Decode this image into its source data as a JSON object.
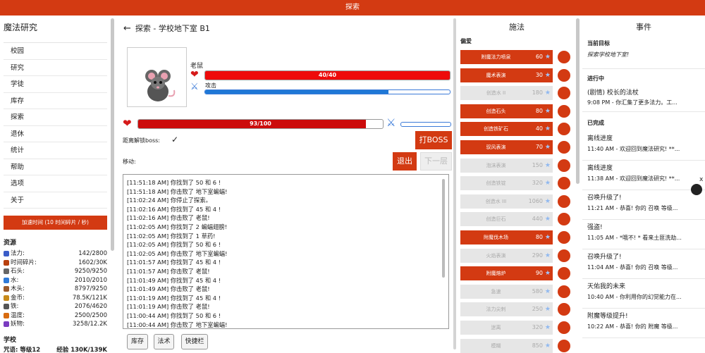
{
  "topbar": {
    "title": "探索"
  },
  "left": {
    "title": "魔法研究",
    "nav": [
      "校园",
      "研究",
      "学徒",
      "库存",
      "探索",
      "退休",
      "统计",
      "帮助",
      "选项",
      "关于"
    ],
    "accelerate": "加速时间 (10 时间碎片 / 秒)",
    "resources_title": "资源",
    "resources": [
      {
        "icon": "star-icon",
        "color": "#3a5cc8",
        "name": "法力:",
        "value": "142/2800"
      },
      {
        "icon": "time-shard-icon",
        "color": "#b8400e",
        "name": "时间碎片:",
        "value": "1602/30K"
      },
      {
        "icon": "stone-icon",
        "color": "#666666",
        "name": "石头:",
        "value": "9250/9250"
      },
      {
        "icon": "water-icon",
        "color": "#2f7ad8",
        "name": "水:",
        "value": "2010/2010"
      },
      {
        "icon": "wood-icon",
        "color": "#9a5a2c",
        "name": "木头:",
        "value": "8797/9250"
      },
      {
        "icon": "gold-icon",
        "color": "#c88a1a",
        "name": "金币:",
        "value": "78.5K/121K"
      },
      {
        "icon": "iron-icon",
        "color": "#555555",
        "name": "铁:",
        "value": "2076/4620"
      },
      {
        "icon": "heat-icon",
        "color": "#d86b10",
        "name": "温度:",
        "value": "2500/2500"
      },
      {
        "icon": "potion-icon",
        "color": "#7a3cc0",
        "name": "妖物:",
        "value": "3258/12.2K"
      }
    ],
    "school_title": "学校",
    "school_level": "咒语: 等级12",
    "school_exp": "经验 130K/139K"
  },
  "main": {
    "back_icon": "arrow-left-icon",
    "title": "探索 - 学校地下室 B1",
    "monster_name": "老鼠",
    "monster_hp_text": "40/40",
    "monster_hp_pct": 100,
    "monster_attack_label": "攻击",
    "monster_attack_pct": 75,
    "player_hp_text": "93/100",
    "player_hp_pct": 93,
    "player_attack_pct": 0,
    "boss_label": "距离解锁boss:",
    "boss_check": "✓",
    "boss_button": "打BOSS",
    "move_label": "移动:",
    "exit_button": "退出",
    "next_button": "下一层",
    "log": [
      "[11:51:18 AM] 你找到了 50 和 6 !",
      "[11:51:18 AM] 你击败了 地下室蝙蝠!",
      "[11:02:24 AM] 你停止了探索。",
      "[11:02:16 AM] 你找到了 45 和 4 !",
      "[11:02:16 AM] 你击败了 老鼠!",
      "[11:02:05 AM] 你找到了 2 蝙蝠翅膀!",
      "[11:02:05 AM] 你找到了 1 草药!",
      "[11:02:05 AM] 你找到了 50 和 6 !",
      "[11:02:05 AM] 你击败了 地下室蝙蝠!",
      "[11:01:57 AM] 你找到了 45 和 4 !",
      "[11:01:57 AM] 你击败了 老鼠!",
      "[11:01:49 AM] 你找到了 45 和 4 !",
      "[11:01:49 AM] 你击败了 老鼠!",
      "[11:01:19 AM] 你找到了 45 和 4 !",
      "[11:01:19 AM] 你击败了 老鼠!",
      "[11:00:44 AM] 你找到了 50 和 6 !",
      "[11:00:44 AM] 你击败了 地下室蝙蝠!"
    ],
    "tabs": [
      "库存",
      "法术",
      "快捷栏"
    ]
  },
  "spells": {
    "title": "施法",
    "fav_label": "偏爱",
    "items": [
      {
        "name": "附魔法力喷泉",
        "count": "60",
        "on": true
      },
      {
        "name": "魔术表演",
        "count": "30",
        "on": true
      },
      {
        "name": "创造水 II",
        "count": "180",
        "on": false
      },
      {
        "name": "创造石头",
        "count": "80",
        "on": true
      },
      {
        "name": "创造铁矿石",
        "count": "40",
        "on": true
      },
      {
        "name": "驭风表演",
        "count": "70",
        "on": true
      },
      {
        "name": "泡沫表演",
        "count": "150",
        "on": false
      },
      {
        "name": "创造铁锭",
        "count": "320",
        "on": false
      },
      {
        "name": "创造水 III",
        "count": "1060",
        "on": false
      },
      {
        "name": "创造巨石",
        "count": "440",
        "on": false
      },
      {
        "name": "附魔伐木场",
        "count": "80",
        "on": true
      },
      {
        "name": "火焰表演",
        "count": "290",
        "on": false
      },
      {
        "name": "附魔熔炉",
        "count": "90",
        "on": true
      },
      {
        "name": "急速",
        "count": "580",
        "on": false
      },
      {
        "name": "法力尖刺",
        "count": "250",
        "on": false
      },
      {
        "name": "迷离",
        "count": "320",
        "on": false
      },
      {
        "name": "模糊",
        "count": "850",
        "on": false
      }
    ]
  },
  "events": {
    "title": "事件",
    "current_goal_label": "当前目标",
    "current_goal": "探索学校地下室!",
    "in_progress_label": "进行中",
    "in_progress": [
      {
        "title": "(剧情) 校长的法杖",
        "detail": "9:08 PM - 你汇集了更多法力。工..."
      }
    ],
    "done_label": "已完成",
    "done": [
      {
        "title": "离线进度",
        "detail": "11:40 AM - 欢迎回到魔法研究! **..."
      },
      {
        "title": "离线进度",
        "detail": "11:38 AM - 欢迎回到魔法研究! **..."
      },
      {
        "title": "召唤升级了!",
        "detail": "11:21 AM - 恭喜! 你的 召唤 等级..."
      },
      {
        "title": "强盗!",
        "detail": "11:05 AM - *哦不! * 看来土匪洗劫..."
      },
      {
        "title": "召唤升级了!",
        "detail": "11:04 AM - 恭喜! 你的 召唤 等级..."
      },
      {
        "title": "天佑我的未来",
        "detail": "10:40 AM - 你利用你的幻觉能力在..."
      },
      {
        "title": "附魔等级提升!",
        "detail": "10:22 AM - 恭喜! 你的 附魔 等级..."
      }
    ],
    "close_label": "x"
  }
}
